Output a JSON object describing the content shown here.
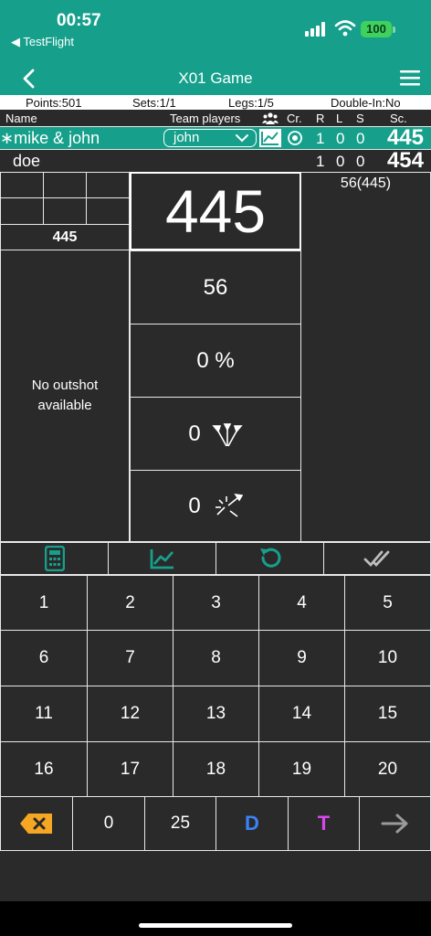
{
  "status": {
    "time": "00:57",
    "back_app": "◀ TestFlight",
    "battery": "100"
  },
  "nav": {
    "title": "X01 Game"
  },
  "info": {
    "points": "Points:501",
    "sets": "Sets:1/1",
    "legs": "Legs:1/5",
    "double_in": "Double-In:No"
  },
  "header": {
    "name": "Name",
    "team_players": "Team players",
    "cr": "Cr.",
    "r": "R",
    "l": "L",
    "s": "S",
    "sc": "Sc."
  },
  "players": [
    {
      "name": "∗mike & john",
      "selected_player": "john",
      "r": "1",
      "l": "0",
      "s": "0",
      "score": "445"
    },
    {
      "name": "doe",
      "r": "1",
      "l": "0",
      "s": "0",
      "score": "454"
    }
  ],
  "history": "56(445)",
  "board": {
    "mini_total": "445",
    "big_score": "445",
    "outshot": "No outshot\navailable",
    "last_score": "56",
    "percent": "0 %",
    "darts_count": "0",
    "bust_count": "0"
  },
  "keypad": {
    "rows": [
      [
        "1",
        "2",
        "3",
        "4",
        "5"
      ],
      [
        "6",
        "7",
        "8",
        "9",
        "10"
      ],
      [
        "11",
        "12",
        "13",
        "14",
        "15"
      ],
      [
        "16",
        "17",
        "18",
        "19",
        "20"
      ]
    ],
    "zero": "0",
    "bull": "25",
    "double": "D",
    "triple": "T"
  },
  "colors": {
    "accent": "#16a08c",
    "double": "#3b82f6",
    "triple": "#d946ef",
    "backspace": "#f5a623"
  }
}
